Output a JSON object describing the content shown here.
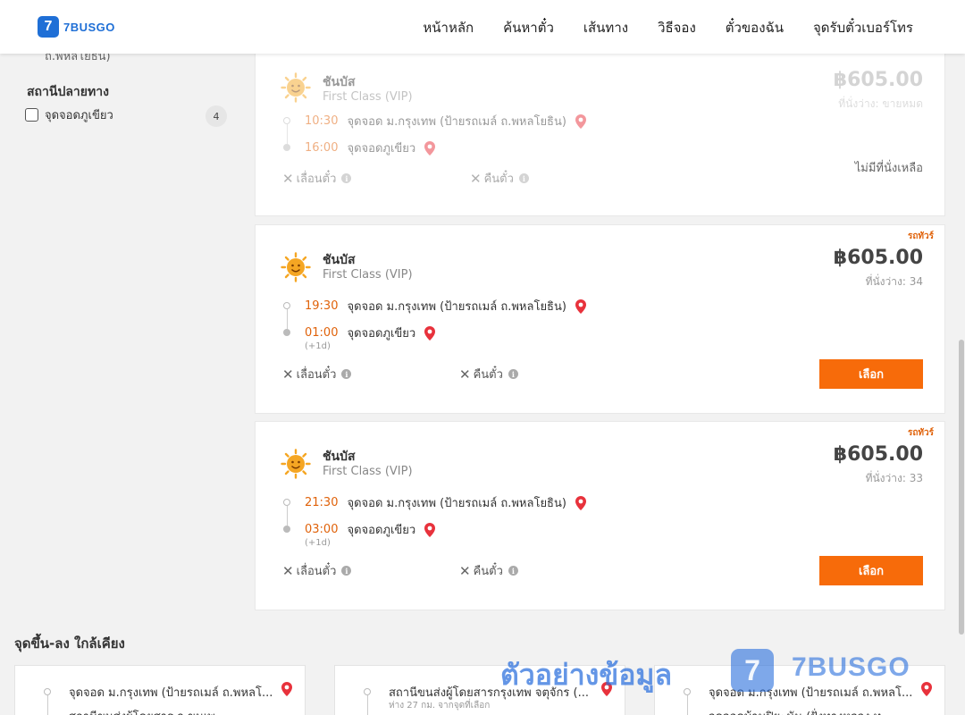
{
  "header": {
    "logo_text": "7BUSGO",
    "logo_badge": "7",
    "nav": [
      "หน้าหลัก",
      "ค้นหาตั๋ว",
      "เส้นทาง",
      "วิธีจอง",
      "ตั๋วของฉัน",
      "จุดรับตั๋วเบอร์โทร"
    ]
  },
  "sidebar": {
    "cut_text": "ถ.พหลโยธิน)",
    "filter_title": "สถานีปลายทาง",
    "option_label": "จุดจอดภูเขียว",
    "option_count": "4"
  },
  "trips": [
    {
      "company": "ชันบัส",
      "class": "First Class (VIP)",
      "tag": "",
      "price": "฿605.00",
      "seats": "ที่นั่งว่าง: ขายหมด",
      "dep_time": "10:30",
      "dep_stop": "จุดจอด ม.กรุงเทพ (ป้ายรถเมล์ ถ.พหลโยธิน)",
      "arr_time": "16:00",
      "arr_stop": "จุดจอดภูเขียว",
      "next_day": "",
      "change_label": "เลื่อนตั๋ว",
      "refund_label": "คืนตั๋ว",
      "status": "ไม่มีที่นั่งเหลือ",
      "button": ""
    },
    {
      "company": "ชันบัส",
      "class": "First Class (VIP)",
      "tag": "รถทัวร์",
      "price": "฿605.00",
      "seats": "ที่นั่งว่าง: 34",
      "dep_time": "19:30",
      "dep_stop": "จุดจอด ม.กรุงเทพ (ป้ายรถเมล์ ถ.พหลโยธิน)",
      "arr_time": "01:00",
      "arr_stop": "จุดจอดภูเขียว",
      "next_day": "(+1d)",
      "change_label": "เลื่อนตั๋ว",
      "refund_label": "คืนตั๋ว",
      "status": "",
      "button": "เลือก"
    },
    {
      "company": "ชันบัส",
      "class": "First Class (VIP)",
      "tag": "รถทัวร์",
      "price": "฿605.00",
      "seats": "ที่นั่งว่าง: 33",
      "dep_time": "21:30",
      "dep_stop": "จุดจอด ม.กรุงเทพ (ป้ายรถเมล์ ถ.พหลโยธิน)",
      "arr_time": "03:00",
      "arr_stop": "จุดจอดภูเขียว",
      "next_day": "(+1d)",
      "change_label": "เลื่อนตั๋ว",
      "refund_label": "คืนตั๋ว",
      "status": "",
      "button": "เลือก"
    }
  ],
  "nearby": {
    "title": "จุดขึ้น-ลง ใกล้เคียง",
    "cards": [
      {
        "name": "จุดจอด ม.กรุงเทพ (ป้ายรถเมล์ ถ.พหลโ...",
        "sub": "",
        "name2": "สถานีขนส่งผู้โดยสาร ก.ขนเพ..."
      },
      {
        "name": "สถานีขนส่งผู้โดยสารกรุงเทพ จตุจักร (...",
        "sub": "ห่าง 27 กม. จากจุดที่เลือก",
        "name2": ""
      },
      {
        "name": "จุดจอด ม.กรุงเทพ (ป้ายรถเมล์ ถ.พหลโ...",
        "sub": "",
        "name2": "จุดจอดบ้านปิยะนัน (ฝั่งทางหลวง ท..."
      }
    ]
  },
  "watermark": {
    "text": "ตัวอย่างข้อมูล",
    "badge": "7",
    "logo": "7BUSGO"
  },
  "colors": {
    "accent": "#f76b0a",
    "time": "#e0620a",
    "brand": "#1f6fd6",
    "pin": "#e8323c"
  }
}
